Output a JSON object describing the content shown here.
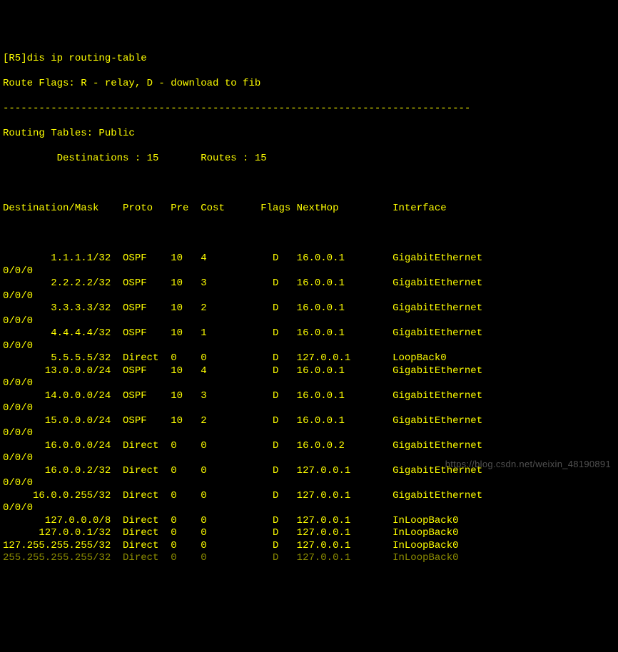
{
  "prompt": "[R5]dis ip routing-table",
  "flags_legend": "Route Flags: R - relay, D - download to fib",
  "separator": "------------------------------------------------------------------------------",
  "tables_header": "Routing Tables: Public",
  "stats_line": "         Destinations : 15       Routes : 15",
  "columns": "Destination/Mask    Proto   Pre  Cost      Flags NextHop         Interface",
  "routes": [
    {
      "dest": "1.1.1.1/32",
      "proto": "OSPF",
      "pre": "10",
      "cost": "4",
      "flags": "D",
      "nexthop": "16.0.0.1",
      "iface": "GigabitEthernet",
      "wrap": "0/0/0"
    },
    {
      "dest": "2.2.2.2/32",
      "proto": "OSPF",
      "pre": "10",
      "cost": "3",
      "flags": "D",
      "nexthop": "16.0.0.1",
      "iface": "GigabitEthernet",
      "wrap": "0/0/0"
    },
    {
      "dest": "3.3.3.3/32",
      "proto": "OSPF",
      "pre": "10",
      "cost": "2",
      "flags": "D",
      "nexthop": "16.0.0.1",
      "iface": "GigabitEthernet",
      "wrap": "0/0/0"
    },
    {
      "dest": "4.4.4.4/32",
      "proto": "OSPF",
      "pre": "10",
      "cost": "1",
      "flags": "D",
      "nexthop": "16.0.0.1",
      "iface": "GigabitEthernet",
      "wrap": "0/0/0"
    },
    {
      "dest": "5.5.5.5/32",
      "proto": "Direct",
      "pre": "0",
      "cost": "0",
      "flags": "D",
      "nexthop": "127.0.0.1",
      "iface": "LoopBack0",
      "wrap": null
    },
    {
      "dest": "13.0.0.0/24",
      "proto": "OSPF",
      "pre": "10",
      "cost": "4",
      "flags": "D",
      "nexthop": "16.0.0.1",
      "iface": "GigabitEthernet",
      "wrap": "0/0/0"
    },
    {
      "dest": "14.0.0.0/24",
      "proto": "OSPF",
      "pre": "10",
      "cost": "3",
      "flags": "D",
      "nexthop": "16.0.0.1",
      "iface": "GigabitEthernet",
      "wrap": "0/0/0"
    },
    {
      "dest": "15.0.0.0/24",
      "proto": "OSPF",
      "pre": "10",
      "cost": "2",
      "flags": "D",
      "nexthop": "16.0.0.1",
      "iface": "GigabitEthernet",
      "wrap": "0/0/0"
    },
    {
      "dest": "16.0.0.0/24",
      "proto": "Direct",
      "pre": "0",
      "cost": "0",
      "flags": "D",
      "nexthop": "16.0.0.2",
      "iface": "GigabitEthernet",
      "wrap": "0/0/0"
    },
    {
      "dest": "16.0.0.2/32",
      "proto": "Direct",
      "pre": "0",
      "cost": "0",
      "flags": "D",
      "nexthop": "127.0.0.1",
      "iface": "GigabitEthernet",
      "wrap": "0/0/0"
    },
    {
      "dest": "16.0.0.255/32",
      "proto": "Direct",
      "pre": "0",
      "cost": "0",
      "flags": "D",
      "nexthop": "127.0.0.1",
      "iface": "GigabitEthernet",
      "wrap": "0/0/0"
    },
    {
      "dest": "127.0.0.0/8",
      "proto": "Direct",
      "pre": "0",
      "cost": "0",
      "flags": "D",
      "nexthop": "127.0.0.1",
      "iface": "InLoopBack0",
      "wrap": null
    },
    {
      "dest": "127.0.0.1/32",
      "proto": "Direct",
      "pre": "0",
      "cost": "0",
      "flags": "D",
      "nexthop": "127.0.0.1",
      "iface": "InLoopBack0",
      "wrap": null
    },
    {
      "dest": "127.255.255.255/32",
      "proto": "Direct",
      "pre": "0",
      "cost": "0",
      "flags": "D",
      "nexthop": "127.0.0.1",
      "iface": "InLoopBack0",
      "wrap": null
    },
    {
      "dest": "255.255.255.255/32",
      "proto": "Direct",
      "pre": "0",
      "cost": "0",
      "flags": "D",
      "nexthop": "127.0.0.1",
      "iface": "InLoopBack0",
      "wrap": null,
      "faded": true
    }
  ],
  "watermark": "https://blog.csdn.net/weixin_48190891"
}
